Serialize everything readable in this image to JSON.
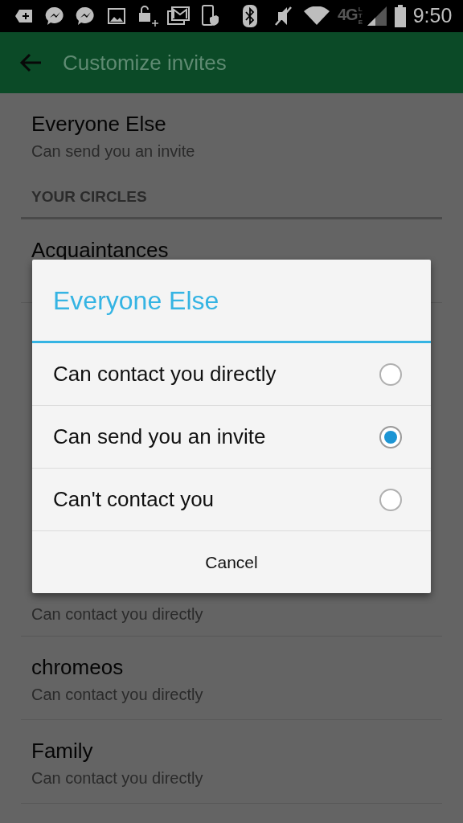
{
  "status_bar": {
    "network_type": "4G",
    "network_sub": "LTE",
    "time": "9:50"
  },
  "app_bar": {
    "title": "Customize invites"
  },
  "default_setting": {
    "title": "Everyone Else",
    "subtitle": "Can send you an invite"
  },
  "section_header": "YOUR CIRCLES",
  "circles": [
    {
      "title": "Acquaintances"
    },
    {
      "subtitle": "Can contact you directly"
    },
    {
      "title": "chromeos",
      "subtitle": "Can contact you directly"
    },
    {
      "title": "Family",
      "subtitle": "Can contact you directly"
    }
  ],
  "dialog": {
    "title": "Everyone Else",
    "options": [
      {
        "label": "Can contact you directly",
        "selected": false
      },
      {
        "label": "Can send you an invite",
        "selected": true
      },
      {
        "label": "Can't contact you",
        "selected": false
      }
    ],
    "cancel": "Cancel"
  }
}
